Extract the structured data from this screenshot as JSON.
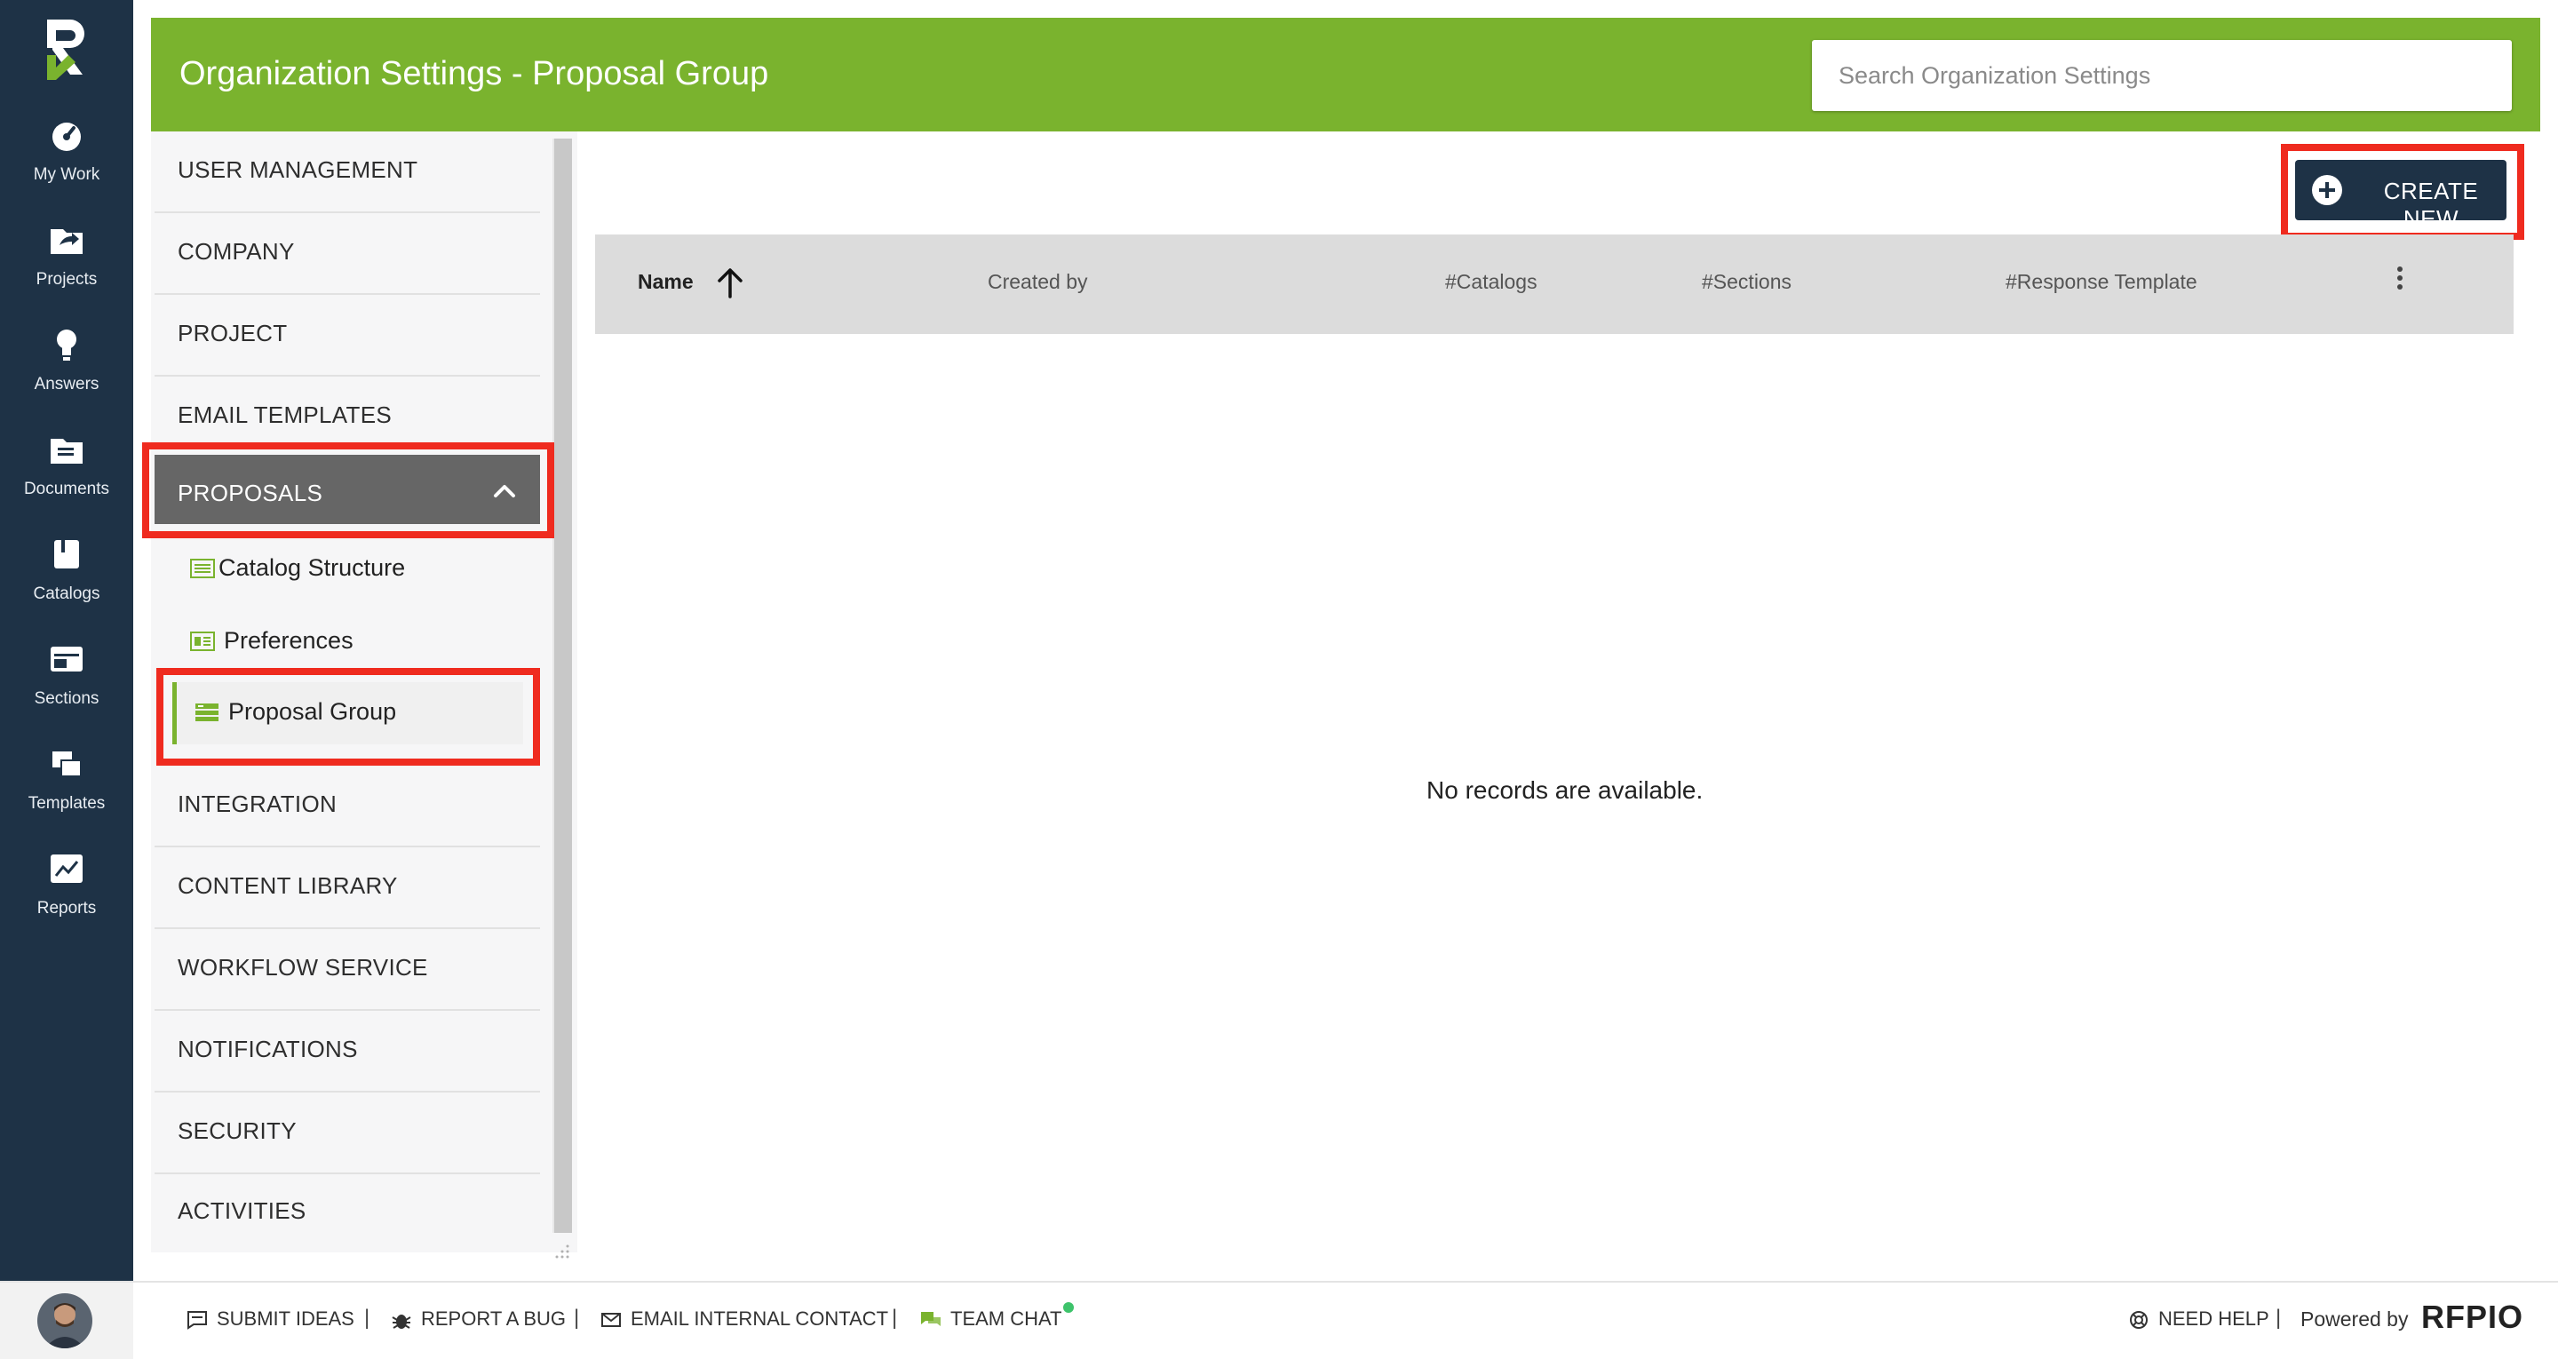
{
  "app": {
    "header_title": "Organization Settings - Proposal Group",
    "search_placeholder": "Search Organization Settings"
  },
  "leftnav": [
    {
      "label": "My Work",
      "icon": "speedometer-icon"
    },
    {
      "label": "Projects",
      "icon": "folder-share-icon"
    },
    {
      "label": "Answers",
      "icon": "lightbulb-icon"
    },
    {
      "label": "Documents",
      "icon": "documents-icon"
    },
    {
      "label": "Catalogs",
      "icon": "book-icon"
    },
    {
      "label": "Sections",
      "icon": "sections-icon"
    },
    {
      "label": "Templates",
      "icon": "templates-icon"
    },
    {
      "label": "Reports",
      "icon": "chart-icon"
    }
  ],
  "menu": {
    "items": [
      {
        "label": "USER MANAGEMENT"
      },
      {
        "label": "COMPANY"
      },
      {
        "label": "PROJECT"
      },
      {
        "label": "EMAIL TEMPLATES"
      },
      {
        "label": "PROPOSALS"
      },
      {
        "label": "INTEGRATION"
      },
      {
        "label": "CONTENT LIBRARY"
      },
      {
        "label": "WORKFLOW SERVICE"
      },
      {
        "label": "NOTIFICATIONS"
      },
      {
        "label": "SECURITY"
      },
      {
        "label": "ACTIVITIES"
      }
    ],
    "sub_items": [
      {
        "label": "Catalog Structure"
      },
      {
        "label": "Preferences"
      },
      {
        "label": "Proposal Group"
      }
    ]
  },
  "content": {
    "create_label": "CREATE NEW",
    "columns": [
      "Name",
      "Created by",
      "#Catalogs",
      "#Sections",
      "#Response Template"
    ],
    "empty_message": "No records are available."
  },
  "footer": {
    "links": [
      "SUBMIT IDEAS",
      "REPORT A BUG",
      "EMAIL INTERNAL CONTACT",
      "TEAM CHAT",
      "NEED HELP"
    ],
    "separator": "|",
    "powered_by": "Powered by",
    "brand": "RFPIO"
  },
  "colors": {
    "nav_bg": "#1e3246",
    "header_green": "#7ab32e",
    "highlight_red": "#ef2b1f",
    "active_menu": "#666666"
  }
}
